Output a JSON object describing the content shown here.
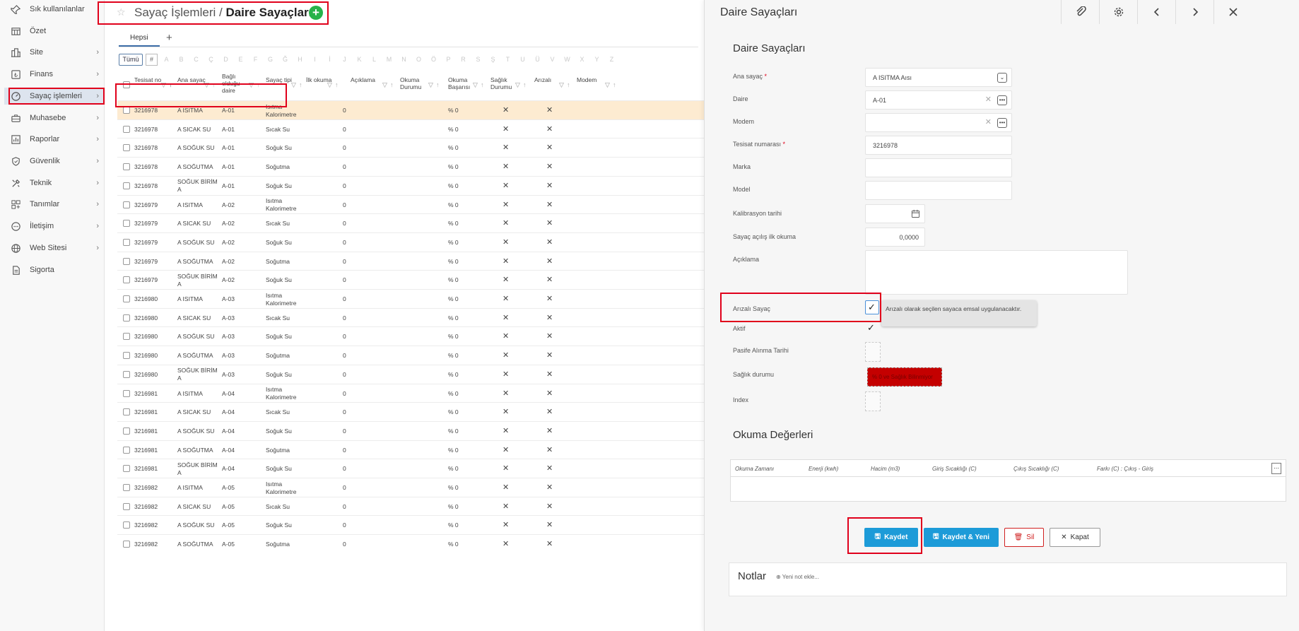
{
  "sidebar": {
    "items": [
      {
        "label": "Sık kullanılanlar",
        "icon": "pin-icon",
        "arrow": false
      },
      {
        "label": "Özet",
        "icon": "table-icon",
        "arrow": false
      },
      {
        "label": "Site",
        "icon": "building-icon",
        "arrow": true
      },
      {
        "label": "Finans",
        "icon": "money-icon",
        "arrow": true
      },
      {
        "label": "Sayaç işlemleri",
        "icon": "gauge-icon",
        "arrow": true,
        "active": true
      },
      {
        "label": "Muhasebe",
        "icon": "briefcase-icon",
        "arrow": true
      },
      {
        "label": "Raporlar",
        "icon": "chart-icon",
        "arrow": true
      },
      {
        "label": "Güvenlik",
        "icon": "shield-icon",
        "arrow": true
      },
      {
        "label": "Teknik",
        "icon": "tools-icon",
        "arrow": true
      },
      {
        "label": "Tanımlar",
        "icon": "grid-plus-icon",
        "arrow": true
      },
      {
        "label": "İletişim",
        "icon": "chat-icon",
        "arrow": true
      },
      {
        "label": "Web Sitesi",
        "icon": "globe-icon",
        "arrow": true
      },
      {
        "label": "Sigorta",
        "icon": "document-icon",
        "arrow": false
      }
    ]
  },
  "header": {
    "title_prefix": "Sayaç İşlemleri / ",
    "title_main": "Daire Sayaçları",
    "add_label": "+"
  },
  "tabs": {
    "active": "Hepsi",
    "add": "+"
  },
  "letters": {
    "all": "Tümü",
    "hash": "#",
    "list": [
      "A",
      "B",
      "C",
      "Ç",
      "D",
      "E",
      "F",
      "G",
      "Ğ",
      "H",
      "I",
      "İ",
      "J",
      "K",
      "L",
      "M",
      "N",
      "O",
      "Ö",
      "P",
      "R",
      "S",
      "Ş",
      "T",
      "U",
      "Ü",
      "V",
      "W",
      "X",
      "Y",
      "Z"
    ]
  },
  "table": {
    "columns": [
      "Tesisat no",
      "Ana sayaç",
      "Bağlı olduğu daire",
      "Sayaç tipi",
      "İlk okuma",
      "Açıklama",
      "Okuma Durumu",
      "Okuma Başarısı",
      "Sağlık Durumu",
      "Arızalı",
      "Modem"
    ],
    "rows": [
      [
        "3216978",
        "A ISITMA",
        "A-01",
        "Isıtma Kalorimetre",
        "0",
        "% 0"
      ],
      [
        "3216978",
        "A SICAK SU",
        "A-01",
        "Sıcak Su",
        "0",
        "% 0"
      ],
      [
        "3216978",
        "A SOĞUK SU",
        "A-01",
        "Soğuk Su",
        "0",
        "% 0"
      ],
      [
        "3216978",
        "A SOĞUTMA",
        "A-01",
        "Soğutma",
        "0",
        "% 0"
      ],
      [
        "3216978",
        "SOĞUK BİRİM A",
        "A-01",
        "Soğuk Su",
        "0",
        "% 0"
      ],
      [
        "3216979",
        "A ISITMA",
        "A-02",
        "Isıtma Kalorimetre",
        "0",
        "% 0"
      ],
      [
        "3216979",
        "A SICAK SU",
        "A-02",
        "Sıcak Su",
        "0",
        "% 0"
      ],
      [
        "3216979",
        "A SOĞUK SU",
        "A-02",
        "Soğuk Su",
        "0",
        "% 0"
      ],
      [
        "3216979",
        "A SOĞUTMA",
        "A-02",
        "Soğutma",
        "0",
        "% 0"
      ],
      [
        "3216979",
        "SOĞUK BİRİM A",
        "A-02",
        "Soğuk Su",
        "0",
        "% 0"
      ],
      [
        "3216980",
        "A ISITMA",
        "A-03",
        "Isıtma Kalorimetre",
        "0",
        "% 0"
      ],
      [
        "3216980",
        "A SICAK SU",
        "A-03",
        "Sıcak Su",
        "0",
        "% 0"
      ],
      [
        "3216980",
        "A SOĞUK SU",
        "A-03",
        "Soğuk Su",
        "0",
        "% 0"
      ],
      [
        "3216980",
        "A SOĞUTMA",
        "A-03",
        "Soğutma",
        "0",
        "% 0"
      ],
      [
        "3216980",
        "SOĞUK BİRİM A",
        "A-03",
        "Soğuk Su",
        "0",
        "% 0"
      ],
      [
        "3216981",
        "A ISITMA",
        "A-04",
        "Isıtma Kalorimetre",
        "0",
        "% 0"
      ],
      [
        "3216981",
        "A SICAK SU",
        "A-04",
        "Sıcak Su",
        "0",
        "% 0"
      ],
      [
        "3216981",
        "A SOĞUK SU",
        "A-04",
        "Soğuk Su",
        "0",
        "% 0"
      ],
      [
        "3216981",
        "A SOĞUTMA",
        "A-04",
        "Soğutma",
        "0",
        "% 0"
      ],
      [
        "3216981",
        "SOĞUK BİRİM A",
        "A-04",
        "Soğuk Su",
        "0",
        "% 0"
      ],
      [
        "3216982",
        "A ISITMA",
        "A-05",
        "Isıtma Kalorimetre",
        "0",
        "% 0"
      ],
      [
        "3216982",
        "A SICAK SU",
        "A-05",
        "Sıcak Su",
        "0",
        "% 0"
      ],
      [
        "3216982",
        "A SOĞUK SU",
        "A-05",
        "Soğuk Su",
        "0",
        "% 0"
      ],
      [
        "3216982",
        "A SOĞUTMA",
        "A-05",
        "Soğutma",
        "0",
        "% 0"
      ]
    ],
    "cross": "✕"
  },
  "panel": {
    "title": "Daire Sayaçları",
    "section": "Daire Sayaçları",
    "fields": {
      "ana_sayac": {
        "label": "Ana sayaç",
        "value": "A ISITMA Aısı"
      },
      "daire": {
        "label": "Daire",
        "value": "A-01"
      },
      "modem": {
        "label": "Modem",
        "value": ""
      },
      "tesisat": {
        "label": "Tesisat numarası",
        "value": "3216978"
      },
      "marka": {
        "label": "Marka",
        "value": ""
      },
      "model": {
        "label": "Model",
        "value": ""
      },
      "kalibrasyon": {
        "label": "Kalibrasyon tarihi",
        "value": ""
      },
      "ilk_okuma": {
        "label": "Sayaç açılış ilk okuma",
        "value": "0,0000"
      },
      "aciklama": {
        "label": "Açıklama",
        "value": ""
      },
      "arizali": {
        "label": "Arızalı Sayaç"
      },
      "aktif": {
        "label": "Aktif"
      },
      "pasife": {
        "label": "Pasife Alınma Tarihi"
      },
      "saglik": {
        "label": "Sağlık durumu",
        "value": "% 0 ve Sağlık Bilinmiyor"
      },
      "index": {
        "label": "Index"
      }
    },
    "tooltip": "Arızalı olarak seçilen sayaca emsal uygulanacaktır.",
    "okuma": {
      "title": "Okuma Değerleri",
      "columns": [
        "Okuma Zamanı",
        "Enerji (kwh)",
        "Hacim (m3)",
        "Giriş Sıcaklığı (C)",
        "Çıkış Sıcaklığı (C)",
        "Farkı (C) : Çıkış - Giriş"
      ]
    },
    "buttons": {
      "save": "Kaydet",
      "save_new": "Kaydet & Yeni",
      "delete": "Sil",
      "close": "Kapat"
    },
    "notes": {
      "title": "Notlar",
      "add": "Yeni not ekle..."
    }
  }
}
